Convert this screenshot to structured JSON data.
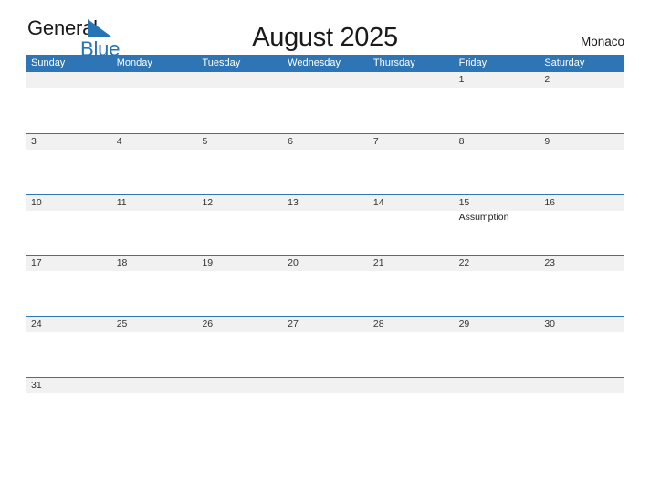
{
  "brand": {
    "name_part1": "General",
    "name_part2": "Blue",
    "flag_icon": "blue-triangle-flag-icon",
    "color_primary": "#2574b5",
    "color_text": "#1a1a1a"
  },
  "header": {
    "title": "August 2025",
    "location": "Monaco"
  },
  "theme": {
    "header_bar_color": "#2e75b6",
    "date_band_color": "#f1f1f1",
    "row_divider_color": "#2e75b6",
    "page_background": "#ffffff"
  },
  "calendar": {
    "month": "August",
    "year": "2025",
    "weekday_headers": [
      "Sunday",
      "Monday",
      "Tuesday",
      "Wednesday",
      "Thursday",
      "Friday",
      "Saturday"
    ],
    "weeks": [
      [
        {
          "date": "",
          "event": ""
        },
        {
          "date": "",
          "event": ""
        },
        {
          "date": "",
          "event": ""
        },
        {
          "date": "",
          "event": ""
        },
        {
          "date": "",
          "event": ""
        },
        {
          "date": "1",
          "event": ""
        },
        {
          "date": "2",
          "event": ""
        }
      ],
      [
        {
          "date": "3",
          "event": ""
        },
        {
          "date": "4",
          "event": ""
        },
        {
          "date": "5",
          "event": ""
        },
        {
          "date": "6",
          "event": ""
        },
        {
          "date": "7",
          "event": ""
        },
        {
          "date": "8",
          "event": ""
        },
        {
          "date": "9",
          "event": ""
        }
      ],
      [
        {
          "date": "10",
          "event": ""
        },
        {
          "date": "11",
          "event": ""
        },
        {
          "date": "12",
          "event": ""
        },
        {
          "date": "13",
          "event": ""
        },
        {
          "date": "14",
          "event": ""
        },
        {
          "date": "15",
          "event": "Assumption"
        },
        {
          "date": "16",
          "event": ""
        }
      ],
      [
        {
          "date": "17",
          "event": ""
        },
        {
          "date": "18",
          "event": ""
        },
        {
          "date": "19",
          "event": ""
        },
        {
          "date": "20",
          "event": ""
        },
        {
          "date": "21",
          "event": ""
        },
        {
          "date": "22",
          "event": ""
        },
        {
          "date": "23",
          "event": ""
        }
      ],
      [
        {
          "date": "24",
          "event": ""
        },
        {
          "date": "25",
          "event": ""
        },
        {
          "date": "26",
          "event": ""
        },
        {
          "date": "27",
          "event": ""
        },
        {
          "date": "28",
          "event": ""
        },
        {
          "date": "29",
          "event": ""
        },
        {
          "date": "30",
          "event": ""
        }
      ],
      [
        {
          "date": "31",
          "event": ""
        },
        {
          "date": "",
          "event": ""
        },
        {
          "date": "",
          "event": ""
        },
        {
          "date": "",
          "event": ""
        },
        {
          "date": "",
          "event": ""
        },
        {
          "date": "",
          "event": ""
        },
        {
          "date": "",
          "event": ""
        }
      ]
    ]
  }
}
